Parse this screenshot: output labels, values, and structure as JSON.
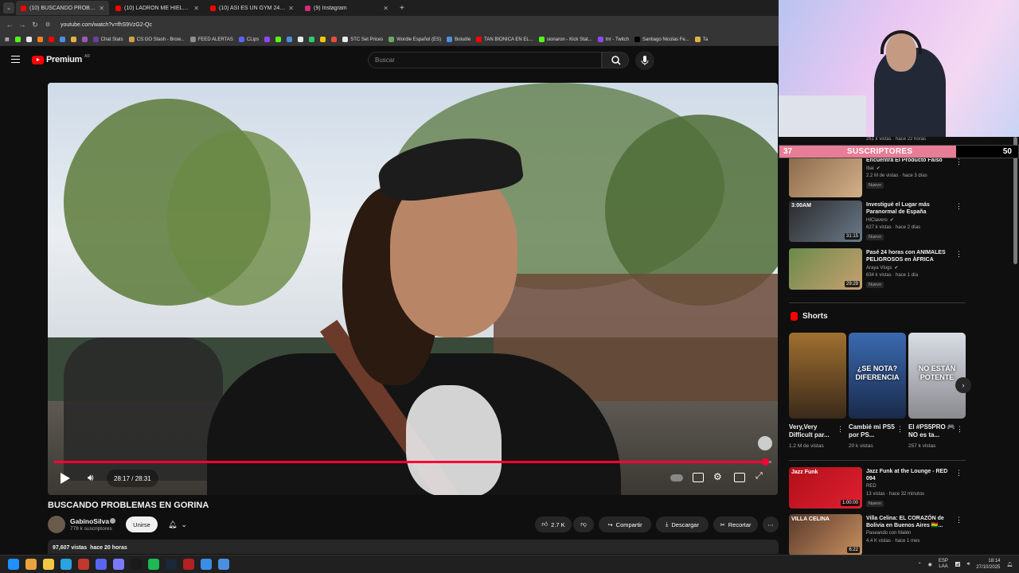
{
  "browser": {
    "tabs": [
      {
        "title": "(10) BUSCANDO PROBLEMAS E",
        "active": true,
        "icon": "youtube-favicon"
      },
      {
        "title": "(10) LADRÓN ME HIELA LA SAN",
        "active": false,
        "icon": "youtube-favicon"
      },
      {
        "title": "(10) ASÍ ES UN GYM 24 HORAS",
        "active": false,
        "icon": "youtube-favicon"
      },
      {
        "title": "(9) Instagram",
        "active": false,
        "icon": "instagram-favicon"
      }
    ],
    "new_tab": "+",
    "url": "youtube.com/watch?v=fhS9VzG2-Qc",
    "bookmarks": [
      {
        "label": "",
        "color": "#53fc18"
      },
      {
        "label": "",
        "color": "#e8e8e8"
      },
      {
        "label": "",
        "color": "#f48024"
      },
      {
        "label": "",
        "color": "#ff0000"
      },
      {
        "label": "",
        "color": "#4a90e2"
      },
      {
        "label": "",
        "color": "#e3b341"
      },
      {
        "label": "",
        "color": "#9b59b6"
      },
      {
        "label": "Chat Stats",
        "color": "#6441a5"
      },
      {
        "label": "CS:GO Stash - Brow...",
        "color": "#cfa04a"
      },
      {
        "label": "FEED ALERTAS",
        "color": "#8e8e8e"
      },
      {
        "label": "CLips",
        "color": "#5865f2"
      },
      {
        "label": "",
        "color": "#9146ff"
      },
      {
        "label": "",
        "color": "#53fc18"
      },
      {
        "label": "",
        "color": "#4a90e2"
      },
      {
        "label": "",
        "color": "#e8e8e8"
      },
      {
        "label": "",
        "color": "#2ecc71"
      },
      {
        "label": "",
        "color": "#f1c40f"
      },
      {
        "label": "",
        "color": "#e74c3c"
      },
      {
        "label": "STC Set Prices",
        "color": "#e8e8e8"
      },
      {
        "label": "Wordle Español (ES)",
        "color": "#6aaa64"
      },
      {
        "label": "Boludle",
        "color": "#4a90e2"
      },
      {
        "label": "TAN BIONICA EN EL...",
        "color": "#ff0000"
      },
      {
        "label": "sionaron - Kick Stat...",
        "color": "#53fc18"
      },
      {
        "label": "tnr - Twitch",
        "color": "#9146ff"
      },
      {
        "label": "Santiago Nicolas Fe...",
        "color": "#000000"
      },
      {
        "label": "Ta",
        "color": "#e3b341"
      }
    ]
  },
  "youtube": {
    "logo_text": "Premium",
    "country": "AR",
    "search_placeholder": "Buscar",
    "player": {
      "time_display": "28:17 / 28:31",
      "progress": 0.9906
    },
    "video_title": "BUSCANDO PROBLEMAS EN GORINA",
    "channel": {
      "name": "GabinoSilva",
      "subs": "778 k suscriptores",
      "join_label": "Unirse"
    },
    "actions": {
      "likes": "2.7 K",
      "share": "Compartir",
      "download": "Descargar",
      "clip": "Recortar"
    },
    "description": {
      "views": "97,607 vistas",
      "ago": "hace 20 horas"
    },
    "cut_meta": "261 k vistas · hace 22 horas",
    "recommendations": [
      {
        "title": "Encuentra El Producto Falso",
        "channel": "Ibai",
        "verified": true,
        "meta": "2.2 M de vistas · hace 3 días",
        "badge": "Nuevo",
        "duration": "",
        "color1": "#8a6a4a",
        "color2": "#d4b08a"
      },
      {
        "title": "Investigué el Lugar más Paranormal de España",
        "channel": "HIClavero",
        "verified": true,
        "meta": "627 k vistas · hace 2 días",
        "badge": "Nuevo",
        "duration": "31:15",
        "thumb_text": "3:00AM",
        "color1": "#2a2a2a",
        "color2": "#6a7a8a"
      },
      {
        "title": "Pasé 24 horas con ANIMALES PELIGROSOS en ÁFRICA",
        "channel": "Araya Vlogs",
        "verified": true,
        "meta": "634 k vistas · hace 1 día",
        "badge": "Nuevo",
        "duration": "29:29",
        "color1": "#6a8a4a",
        "color2": "#c8a070"
      }
    ],
    "shorts_label": "Shorts",
    "shorts": [
      {
        "title": "Very,Very Difficult par...",
        "views": "1.2 M de vistas",
        "color1": "#a07030",
        "color2": "#3a2a1a",
        "overlay": ""
      },
      {
        "title": "Cambié mi PS5 por PS...",
        "views": "20 k vistas",
        "color1": "#3a6ab0",
        "color2": "#1a2a4a",
        "overlay": "¿SE NOTA? DIFERENCIA"
      },
      {
        "title": "El #PS5PRO 🎮 NO es ta...",
        "views": "257 k vistas",
        "color1": "#d8dde4",
        "color2": "#8a8a90",
        "overlay": "NO ESTÁN POTENTE"
      }
    ],
    "more_recommendations": [
      {
        "title": "Jazz Funk at the Lounge - RED 094",
        "channel": "RED",
        "verified": false,
        "meta": "13 vistas · hace 32 minutos",
        "badge": "Nuevo",
        "duration": "1:00:00",
        "thumb_text": "Jazz Funk",
        "color1": "#b0101a",
        "color2": "#e02030"
      },
      {
        "title": "Villa Celina: EL CORAZÓN de Bolivia en Buenos Aires 🇧🇴...",
        "channel": "Paseando con Malén",
        "verified": false,
        "meta": "4.4 K vistas · hace 1 mes",
        "badge": "",
        "duration": "6:22",
        "thumb_text": "VILLA CELINA",
        "color1": "#5a3a2a",
        "color2": "#c89060"
      }
    ]
  },
  "overlay": {
    "sub_current": "37",
    "sub_label": "SUSCRIPTORES",
    "sub_goal": "50",
    "sub_progress": 0.74
  },
  "taskbar": {
    "lang1": "ESP",
    "lang2": "LAA",
    "time": "18:14",
    "date": "27/10/2025"
  }
}
